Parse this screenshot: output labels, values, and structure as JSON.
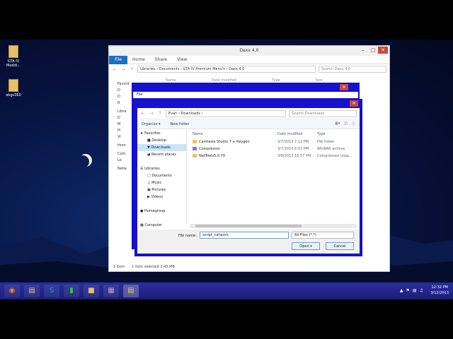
{
  "desktop": {
    "icons": [
      {
        "label": "GTA IV Moddi..."
      },
      {
        "label": "abgs360"
      }
    ]
  },
  "explorer": {
    "title": "Daxx 4.0",
    "ribbon_tabs": [
      "File",
      "Home",
      "Share",
      "View"
    ],
    "breadcrumb": [
      "Libraries",
      "Documents",
      "GTA IV Premium Menu's",
      "Daxx 4.0"
    ],
    "search_placeholder": "Search Daxx 4.0",
    "columns": [
      "Name",
      "Date modified",
      "Type",
      "Size"
    ],
    "nav_fragments": [
      "Favorit",
      "D",
      "D",
      "R",
      "Libra",
      "D",
      "M",
      "Pi",
      "Vi",
      "Hom",
      "Com",
      "Lo",
      "Netw"
    ],
    "status": {
      "count": "1 item",
      "selected": "1 item selected  2.43 MB"
    }
  },
  "file_bar": {
    "text": "File"
  },
  "dialog": {
    "breadcrumb": [
      "Evan",
      "Downloads"
    ],
    "search_placeholder": "Search Downloads",
    "organize_label": "Organize ▾",
    "new_folder_label": "New folder",
    "nav": [
      {
        "label": "Favorites",
        "indent": 0,
        "icon": "star-icon"
      },
      {
        "label": "Desktop",
        "indent": 1,
        "icon": "desktop-icon"
      },
      {
        "label": "Downloads",
        "indent": 1,
        "icon": "downloads-icon",
        "selected": true
      },
      {
        "label": "Recent places",
        "indent": 1,
        "icon": "recent-icon"
      },
      {
        "label": "",
        "indent": 0
      },
      {
        "label": "Libraries",
        "indent": 0,
        "icon": "library-icon"
      },
      {
        "label": "Documents",
        "indent": 1,
        "icon": "documents-icon"
      },
      {
        "label": "Music",
        "indent": 1,
        "icon": "music-icon"
      },
      {
        "label": "Pictures",
        "indent": 1,
        "icon": "pictures-icon"
      },
      {
        "label": "Videos",
        "indent": 1,
        "icon": "videos-icon"
      },
      {
        "label": "",
        "indent": 0
      },
      {
        "label": "Homegroup",
        "indent": 0,
        "icon": "homegroup-icon"
      },
      {
        "label": "",
        "indent": 0
      },
      {
        "label": "Computer",
        "indent": 0,
        "icon": "computer-icon"
      }
    ],
    "columns": [
      "Name",
      "Date modified",
      "Type"
    ],
    "files": [
      {
        "name": "Camtasia Studio 7 + Keygen",
        "date": "3/7/2013 7:12 PM",
        "type": "File folder"
      },
      {
        "name": "Compressor",
        "date": "3/7/2013 6:51 PM",
        "type": "WinRAR archive"
      },
      {
        "name": "NetTools5.0.70",
        "date": "3/8/2013 10:57 PM",
        "type": "Compressed (zipp..."
      }
    ],
    "filename_label": "File name:",
    "filename_value": "script_network",
    "filetype_value": "All Files (*.*)",
    "open_label": "Open",
    "cancel_label": "Cancel"
  },
  "taskbar": {
    "clock_time": "12:32 PM",
    "clock_date": "3/12/2013"
  }
}
